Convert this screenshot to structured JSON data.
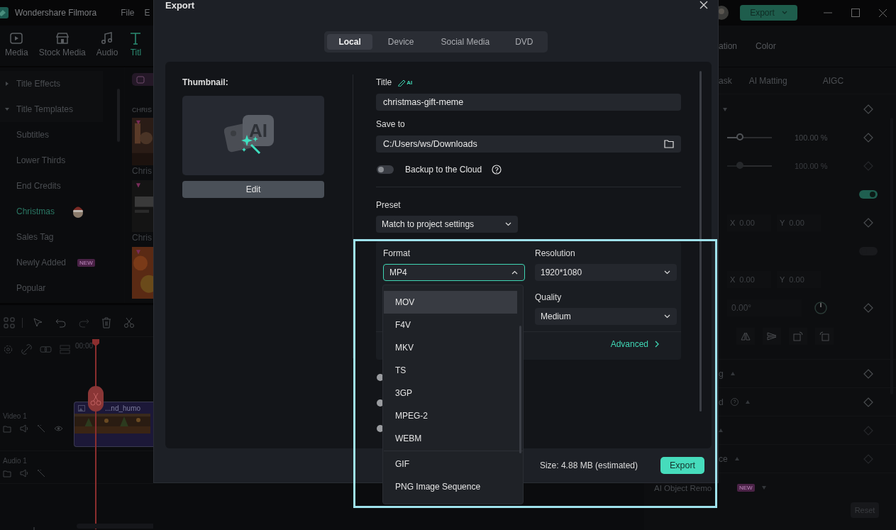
{
  "app": {
    "name": "Wondershare Filmora",
    "menu": [
      "File",
      "E"
    ],
    "export_button": "Export"
  },
  "media_tabs": [
    {
      "label": "Media",
      "kind": "media",
      "selected": false
    },
    {
      "label": "Stock Media",
      "kind": "stock",
      "selected": false
    },
    {
      "label": "Audio",
      "kind": "audio",
      "selected": false
    },
    {
      "label": "Titl",
      "kind": "title",
      "selected": true
    }
  ],
  "categories": [
    {
      "label": "Title Effects",
      "kind": "group",
      "expanded": false,
      "selected": false
    },
    {
      "label": "Title Templates",
      "kind": "group",
      "expanded": true,
      "selected": false
    },
    {
      "label": "Subtitles",
      "kind": "item",
      "selected": false
    },
    {
      "label": "Lower Thirds",
      "kind": "item",
      "selected": false
    },
    {
      "label": "End Credits",
      "kind": "item",
      "selected": false
    },
    {
      "label": "Christmas",
      "kind": "seasonal",
      "selected": true
    },
    {
      "label": "Sales Tag",
      "kind": "item",
      "selected": false
    },
    {
      "label": "Newly Added",
      "kind": "item",
      "badge": "NEW",
      "selected": false
    },
    {
      "label": "Popular",
      "kind": "item",
      "selected": false
    }
  ],
  "templates": {
    "heading": "CHRIS",
    "items": [
      {
        "kind": "picture",
        "caption": "Chris"
      },
      {
        "kind": "picture",
        "caption": "Chris"
      },
      {
        "kind": "picture"
      }
    ]
  },
  "timeline": {
    "time": "00:00",
    "clip": "...nd_humo",
    "tracks": [
      {
        "label": "Video 1",
        "kind": "video"
      },
      {
        "label": "Audio 1",
        "kind": "audio"
      }
    ]
  },
  "right_panel": {
    "tabs": [
      "ation",
      "Color"
    ],
    "subtabs": [
      "ask",
      "AI Matting",
      "AIGC"
    ],
    "sliders": [
      {
        "reading": "100.00 %",
        "level": 0.3,
        "disabled": false
      },
      {
        "reading": "100.00 %",
        "level": 0.3,
        "disabled": true
      }
    ],
    "switches": [
      {
        "on": true
      },
      {
        "on": false
      }
    ],
    "positions": [
      [
        {
          "label": "X",
          "value": "0.00"
        },
        {
          "label": "Y",
          "value": "0.00"
        }
      ],
      [
        {
          "label": "X",
          "value": "0.00"
        },
        {
          "label": "Y",
          "value": "0.00"
        }
      ]
    ],
    "rotation": "0.00°",
    "sections": [
      {
        "label": "g",
        "help": false
      },
      {
        "label": "d",
        "help": true
      },
      {
        "help": false
      },
      {
        "label": "ce",
        "help": false
      }
    ],
    "ai_object_remover": {
      "label": "AI Object Remo",
      "badge": "NEW"
    },
    "reset_button": "Reset"
  },
  "export_dialog": {
    "title": "Export",
    "tabs": [
      {
        "label": "Local",
        "selected": true
      },
      {
        "label": "Device",
        "selected": false
      },
      {
        "label": "Social Media",
        "selected": false
      },
      {
        "label": "DVD",
        "selected": false
      }
    ],
    "thumbnail_label": "Thumbnail:",
    "thumbnail_badge": "AI",
    "edit_button": "Edit",
    "title_label": "Title",
    "ai_label": "AI",
    "title_value": "christmas-gift-meme",
    "save_label": "Save to",
    "save_path": "C:/Users/ws/Downloads",
    "backup": {
      "label": "Backup to the Cloud",
      "on": false
    },
    "preset_label": "Preset",
    "preset": "Match to project settings",
    "format_label": "Format",
    "format": "MP4",
    "format_expanded": true,
    "resolution_label": "Resolution",
    "resolution": "1920*1080",
    "quality_label": "Quality",
    "quality": "Medium",
    "advanced": "Advanced",
    "radio_options": [
      {
        "selected": false
      },
      {
        "selected": false
      },
      {
        "selected": false
      }
    ],
    "format_options": [
      {
        "label": "MOV",
        "divider_above": false,
        "selected": true
      },
      {
        "label": "F4V",
        "divider_above": false,
        "selected": false
      },
      {
        "label": "MKV",
        "divider_above": false,
        "selected": false
      },
      {
        "label": "TS",
        "divider_above": false,
        "selected": false
      },
      {
        "label": "3GP",
        "divider_above": false,
        "selected": false
      },
      {
        "label": "MPEG-2",
        "divider_above": false,
        "selected": false
      },
      {
        "label": "WEBM",
        "divider_above": false,
        "selected": false
      },
      {
        "label": "GIF",
        "divider_above": true,
        "selected": false
      },
      {
        "label": "PNG Image Sequence",
        "divider_above": false,
        "selected": false
      }
    ],
    "size": "Size:  4.88 MB (estimated)",
    "export_button": "Export"
  },
  "annotation_frame": true
}
